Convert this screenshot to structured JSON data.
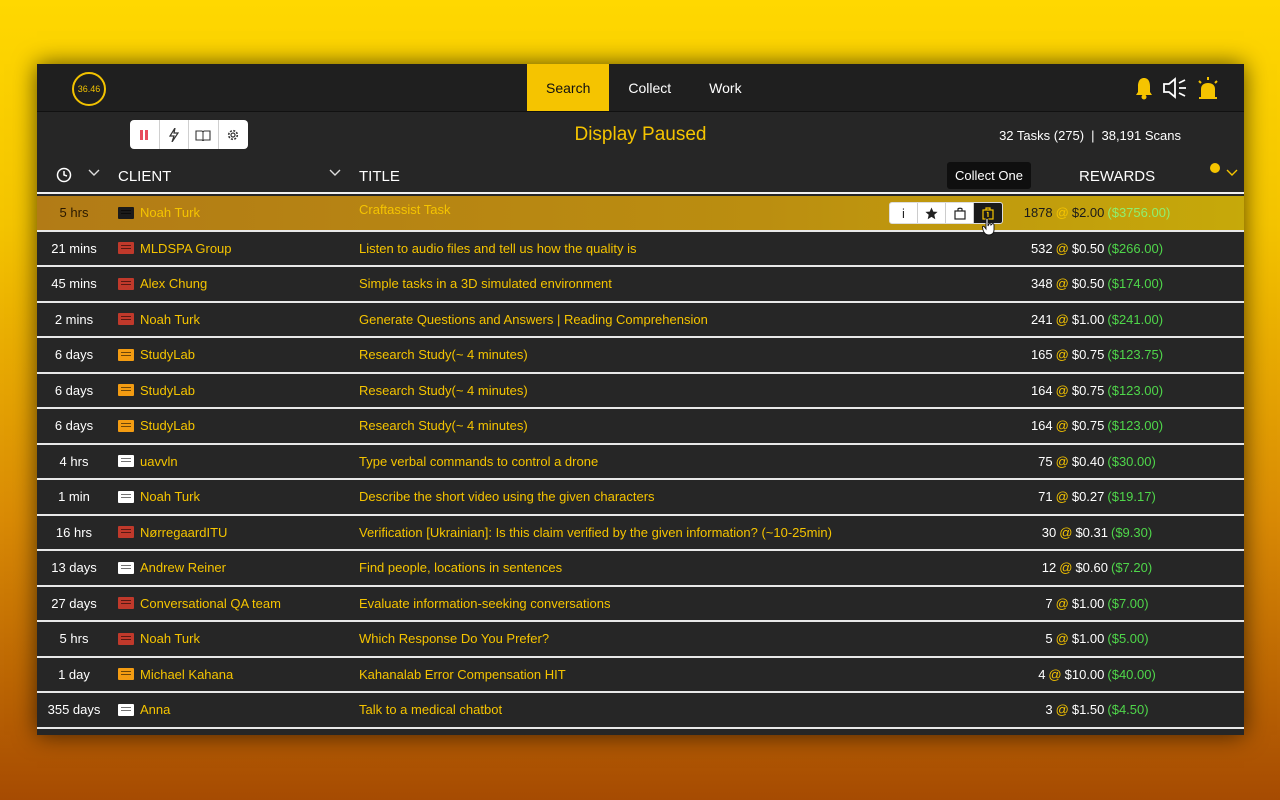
{
  "timer": "36.46",
  "nav": [
    {
      "label": "Search",
      "active": true
    },
    {
      "label": "Collect",
      "active": false
    },
    {
      "label": "Work",
      "active": false
    }
  ],
  "toolbar": {
    "icons": [
      "pause-icon",
      "bolt-icon",
      "book-icon",
      "gear-icon"
    ]
  },
  "status": "Display Paused",
  "counts": {
    "tasks": "32 Tasks (275)",
    "sep": "|",
    "scans": "38,191 Scans"
  },
  "columns": {
    "client": "CLIENT",
    "title": "TITLE",
    "rewards": "REWARDS"
  },
  "tooltip": "Collect One",
  "colors": {
    "accent": "#f5c400",
    "total": "#4fd64a",
    "badge_red": "#c0392b",
    "badge_orange": "#f39c12",
    "badge_white": "#ffffff",
    "badge_black": "#1a1a1a"
  },
  "rows": [
    {
      "age": "5 hrs",
      "client": "Noah Turk",
      "badge": "#1a1a1a",
      "title": "Craftassist Task",
      "count": "1878",
      "price": "$2.00",
      "total": "($3756.00)"
    },
    {
      "age": "21 mins",
      "client": "MLDSPA Group",
      "badge": "#c0392b",
      "title": "Listen to audio files and tell us how the quality is",
      "count": "532",
      "price": "$0.50",
      "total": "($266.00)"
    },
    {
      "age": "45 mins",
      "client": "Alex Chung",
      "badge": "#c0392b",
      "title": "Simple tasks in a 3D simulated environment",
      "count": "348",
      "price": "$0.50",
      "total": "($174.00)"
    },
    {
      "age": "2 mins",
      "client": "Noah Turk",
      "badge": "#c0392b",
      "title": "Generate Questions and Answers | Reading Comprehension",
      "count": "241",
      "price": "$1.00",
      "total": "($241.00)"
    },
    {
      "age": "6 days",
      "client": "StudyLab",
      "badge": "#f39c12",
      "title": "Research Study(~ 4 minutes)",
      "count": "165",
      "price": "$0.75",
      "total": "($123.75)"
    },
    {
      "age": "6 days",
      "client": "StudyLab",
      "badge": "#f39c12",
      "title": "Research Study(~ 4 minutes)",
      "count": "164",
      "price": "$0.75",
      "total": "($123.00)"
    },
    {
      "age": "6 days",
      "client": "StudyLab",
      "badge": "#f39c12",
      "title": "Research Study(~ 4 minutes)",
      "count": "164",
      "price": "$0.75",
      "total": "($123.00)"
    },
    {
      "age": "4 hrs",
      "client": "uavvln",
      "badge": "#ffffff",
      "title": "Type verbal commands to control a drone",
      "count": "75",
      "price": "$0.40",
      "total": "($30.00)"
    },
    {
      "age": "1 min",
      "client": "Noah Turk",
      "badge": "#ffffff",
      "title": "Describe the short video using the given characters",
      "count": "71",
      "price": "$0.27",
      "total": "($19.17)"
    },
    {
      "age": "16 hrs",
      "client": "NørregaardITU",
      "badge": "#c0392b",
      "title": "Verification [Ukrainian]: Is this claim verified by the given information? (~10-25min)",
      "count": "30",
      "price": "$0.31",
      "total": "($9.30)"
    },
    {
      "age": "13 days",
      "client": "Andrew Reiner",
      "badge": "#ffffff",
      "title": "Find people, locations in sentences",
      "count": "12",
      "price": "$0.60",
      "total": "($7.20)"
    },
    {
      "age": "27 days",
      "client": "Conversational QA team",
      "badge": "#c0392b",
      "title": "Evaluate information-seeking conversations",
      "count": "7",
      "price": "$1.00",
      "total": "($7.00)"
    },
    {
      "age": "5 hrs",
      "client": "Noah Turk",
      "badge": "#c0392b",
      "title": "Which Response Do You Prefer?",
      "count": "5",
      "price": "$1.00",
      "total": "($5.00)"
    },
    {
      "age": "1 day",
      "client": "Michael Kahana",
      "badge": "#f39c12",
      "title": "Kahanalab Error Compensation HIT",
      "count": "4",
      "price": "$10.00",
      "total": "($40.00)"
    },
    {
      "age": "355 days",
      "client": "Anna",
      "badge": "#ffffff",
      "title": "Talk to a medical chatbot",
      "count": "3",
      "price": "$1.50",
      "total": "($4.50)"
    }
  ]
}
